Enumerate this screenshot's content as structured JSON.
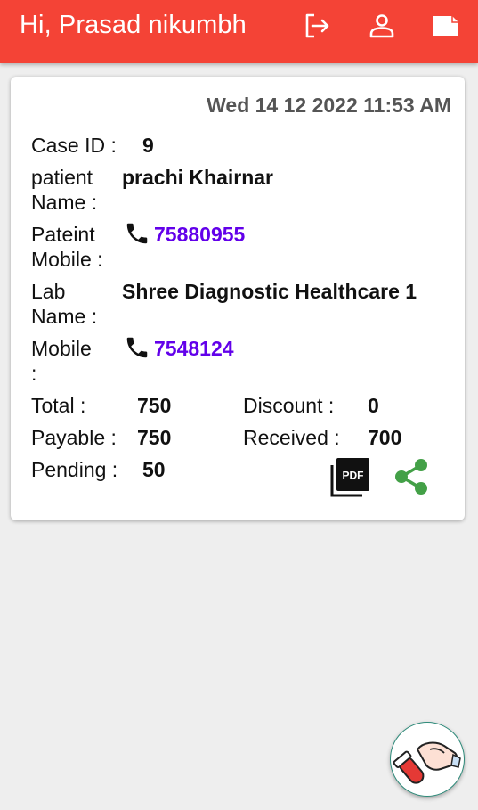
{
  "header": {
    "greeting": "Hi, Prasad nikumbh",
    "icons": [
      "logout-icon",
      "profile-icon",
      "note-icon"
    ],
    "color": "#f44336"
  },
  "case": {
    "date": "Wed 14 12 2022 11:53 AM",
    "case_id_label": "Case ID :",
    "case_id": "9",
    "patient_name_label_1": "patient",
    "patient_name_label_2": "Name :",
    "patient_name": "prachi Khairnar",
    "patient_mobile_label_1": "Pateint",
    "patient_mobile_label_2": "Mobile :",
    "patient_mobile": "75880955",
    "lab_name_label_1": "Lab",
    "lab_name_label_2": "Name :",
    "lab_name": "Shree Diagnostic Healthcare 1",
    "lab_mobile_label_1": "Mobile",
    "lab_mobile_label_2": ":",
    "lab_mobile": "7548124",
    "total_label": "Total :",
    "total": "750",
    "discount_label": "Discount :",
    "discount": "0",
    "payable_label": "Payable :",
    "payable": "750",
    "received_label": "Received :",
    "received": "700",
    "pending_label": "Pending :",
    "pending": "50",
    "action_icons": [
      "pdf-icon",
      "share-icon"
    ],
    "phone_color": "#6200ea",
    "share_color": "#43a047"
  },
  "fab": {
    "icon": "blood-sample-icon"
  }
}
